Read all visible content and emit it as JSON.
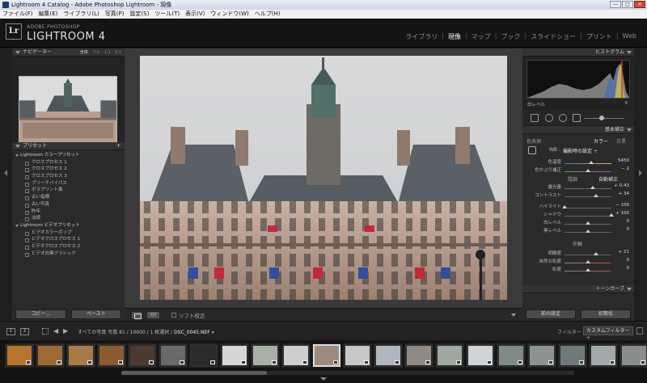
{
  "window": {
    "title": "Lightroom 4 Catalog - Adobe Photoshop Lightroom - 現像",
    "minimize": "—",
    "maximize": "□",
    "close": "✕"
  },
  "menu": [
    "ファイル(F)",
    "編集(E)",
    "ライブラリ(L)",
    "写真(P)",
    "設定(S)",
    "ツール(T)",
    "表示(V)",
    "ウィンドウ(W)",
    "ヘルプ(H)"
  ],
  "identity": {
    "logo": "Lr",
    "small": "ADOBE PHOTOSHOP",
    "big": "LIGHTROOM 4"
  },
  "modules": [
    {
      "label": "ライブラリ",
      "active": false
    },
    {
      "label": "現像",
      "active": true
    },
    {
      "label": "マップ",
      "active": false
    },
    {
      "label": "ブック",
      "active": false
    },
    {
      "label": "スライドショー",
      "active": false
    },
    {
      "label": "プリント",
      "active": false
    },
    {
      "label": "Web",
      "active": false
    }
  ],
  "navigator": {
    "title": "ナビゲーター",
    "zoom_options": [
      "全体",
      "フル",
      "1:1",
      "3:1"
    ]
  },
  "presets": {
    "title": "プリセット",
    "add": "+",
    "rows": [
      {
        "label": "Lightroom カラープリセット",
        "type": "folder"
      },
      {
        "label": "クロスプロセス 1",
        "type": "item"
      },
      {
        "label": "クロスプロセス 2",
        "type": "item"
      },
      {
        "label": "クロスプロセス 3",
        "type": "item"
      },
      {
        "label": "ブリーチバイパス",
        "type": "item"
      },
      {
        "label": "ポラプリント風",
        "type": "item"
      },
      {
        "label": "古い指標",
        "type": "item"
      },
      {
        "label": "古い写真",
        "type": "item"
      },
      {
        "label": "昨年",
        "type": "item"
      },
      {
        "label": "淡調",
        "type": "item"
      },
      {
        "label": "Lightroom ビデオプリセット",
        "type": "folder"
      },
      {
        "label": "ビデオカラーポップ",
        "type": "item"
      },
      {
        "label": "ビデオクロスプロセス 1",
        "type": "item"
      },
      {
        "label": "ビデオクロスプロセス 2",
        "type": "item"
      },
      {
        "label": "ビデオ白黒クラシック",
        "type": "item"
      }
    ]
  },
  "left_buttons": {
    "copy": "コピー...",
    "paste": "ペースト"
  },
  "right_buttons": {
    "previous": "前の設定",
    "reset": "初期化"
  },
  "toolbar": {
    "yy": "Y|Y",
    "soft_proof": "ソフト校正"
  },
  "histogram": {
    "title": "ヒストグラム",
    "label": "白レベル",
    "value": "0"
  },
  "basic": {
    "title": "基本補正",
    "treatment_label": "色表現",
    "treatment_color": "カラー",
    "treatment_bw": "白黒",
    "wb_label": "WB :",
    "wb_value": "撮影時の設定 ÷",
    "temp_label": "色温度",
    "temp_value": "5450",
    "tint_label": "色かぶり補正",
    "tint_value": "− 2",
    "tone_label": "階調",
    "tone_auto": "自動補正",
    "exposure_label": "露光量",
    "exposure_value": "+ 0.43",
    "contrast_label": "コントラスト",
    "contrast_value": "+ 34",
    "highlights_label": "ハイライト",
    "highlights_value": "− 100",
    "shadows_label": "シャドウ",
    "shadows_value": "+ 100",
    "whites_label": "白レベル",
    "whites_value": "0",
    "blacks_label": "黒レベル",
    "blacks_value": "0",
    "presence_label": "外観",
    "clarity_label": "明瞭度",
    "clarity_value": "+ 21",
    "vibrance_label": "自然な彩度",
    "vibrance_value": "0",
    "saturation_label": "彩度",
    "saturation_value": "0",
    "tone_curve_title": "トーンカーブ"
  },
  "filmbar": {
    "page1": "1",
    "page2": "2",
    "back": "◀",
    "forward": "▶",
    "source": "すべての写真",
    "count": "写真 81 / 10600 / 1 枚選択 /",
    "filename": "DSC_0045.NEF",
    "filename_suffix": "▾",
    "filter_label": "フィルター :",
    "filter_value": "カスタムフィルター ÷"
  },
  "accent": {
    "selected_thumb": "#dcdcdc",
    "active_module": "#f2f2f2"
  }
}
